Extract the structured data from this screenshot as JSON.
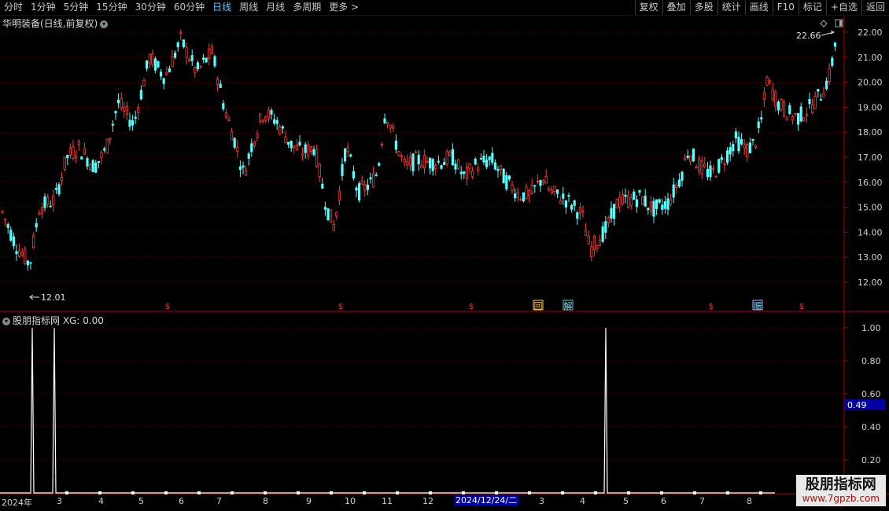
{
  "toolbar": {
    "periods": [
      "分时",
      "1分钟",
      "5分钟",
      "15分钟",
      "30分钟",
      "60分钟",
      "日线",
      "周线",
      "月线",
      "多周期",
      "更多"
    ],
    "active": "日线",
    "right": [
      "复权",
      "叠加",
      "多股",
      "统计",
      "画线",
      "F10",
      "标记",
      "+自选",
      "返回"
    ]
  },
  "chart": {
    "title": "华明装备(日线,前复权)",
    "high_label": "22.66",
    "low_label": "12.01",
    "y_ticks": [
      "22.00",
      "21.00",
      "20.00",
      "19.00",
      "18.00",
      "17.00",
      "16.00",
      "15.00",
      "14.00",
      "13.00",
      "12.00"
    ],
    "markers": [
      "$",
      "$",
      "$",
      "回",
      "解",
      "$",
      "赈",
      "$"
    ]
  },
  "indicator": {
    "title": "股朋指标网 XG: 0.00",
    "y_ticks": [
      "1.00",
      "0.80",
      "0.60",
      "0.40",
      "0.20"
    ],
    "current_value": "0.49"
  },
  "x_axis": {
    "labels": [
      "2024年",
      "3",
      "4",
      "5",
      "6",
      "7",
      "8",
      "9",
      "10",
      "11",
      "12",
      "2024/12/24/二",
      "3",
      "4",
      "5",
      "6",
      "7",
      "8"
    ]
  },
  "watermark": {
    "line1": "股朋指标网",
    "line2": "www.7gpzb.com"
  },
  "colors": {
    "up": "#ff3b3b",
    "down": "#54ffff",
    "accent": "#4ec9ff"
  }
}
